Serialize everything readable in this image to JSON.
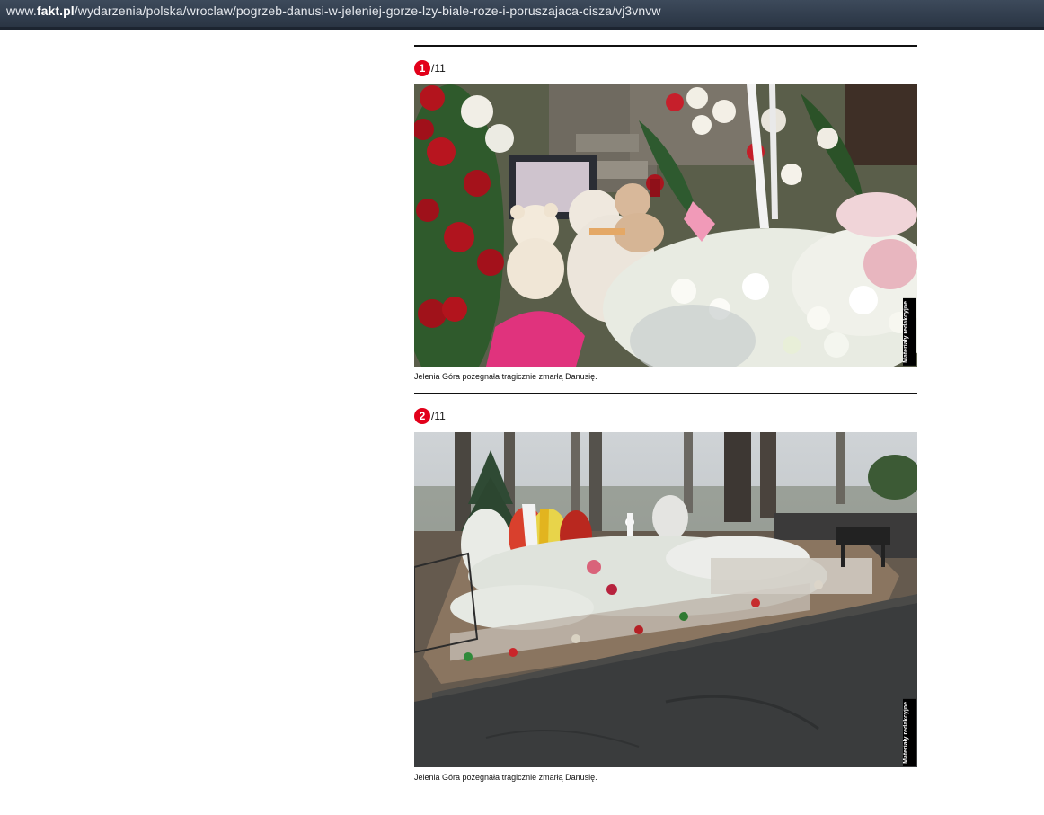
{
  "browser": {
    "url_prefix": "www.",
    "url_domain": "fakt.pl",
    "url_path": "/wydarzenia/polska/wroclaw/pogrzeb-danusi-w-jeleniej-gorze-lzy-biale-roze-i-poruszajaca-cisza/vj3vnvw"
  },
  "gallery": {
    "slides": [
      {
        "index": "1",
        "total": "/11",
        "credit": "Materiały redakcyjne",
        "caption": "Jelenia Góra pożegnała tragicznie zmarłą Danusię."
      },
      {
        "index": "2",
        "total": "/11",
        "credit": "Materiały redakcyjne",
        "caption": "Jelenia Góra pożegnała tragicznie zmarłą Danusię."
      }
    ]
  },
  "colors": {
    "badge": "#e2001a",
    "urlbar": "#2a3544"
  }
}
